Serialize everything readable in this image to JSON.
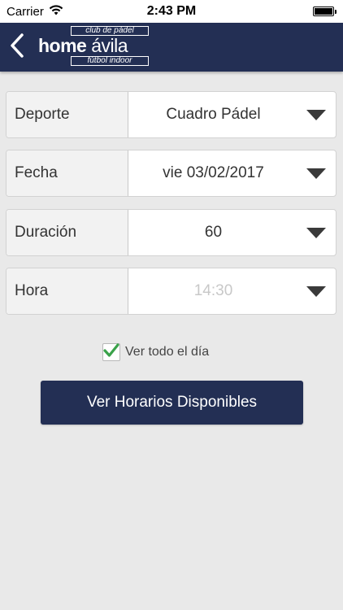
{
  "status_bar": {
    "carrier": "Carrier",
    "time": "2:43 PM"
  },
  "nav": {
    "logo": {
      "top": "club de pádel",
      "main_1": "home",
      "main_2": "ávila",
      "bottom": "fútbol indoor"
    }
  },
  "form": {
    "rows": [
      {
        "label": "Deporte",
        "value": "Cuadro Pádel",
        "enabled": true
      },
      {
        "label": "Fecha",
        "value": "vie 03/02/2017",
        "enabled": true
      },
      {
        "label": "Duración",
        "value": "60",
        "enabled": true
      },
      {
        "label": "Hora",
        "value": "14:30",
        "enabled": false
      }
    ],
    "checkbox": {
      "label": "Ver todo el día",
      "checked": true
    },
    "submit_label": "Ver Horarios Disponibles"
  },
  "colors": {
    "nav_bg": "#232f54",
    "button_bg": "#232f54",
    "check_green": "#3aa24a",
    "background": "#e9e9e9"
  }
}
